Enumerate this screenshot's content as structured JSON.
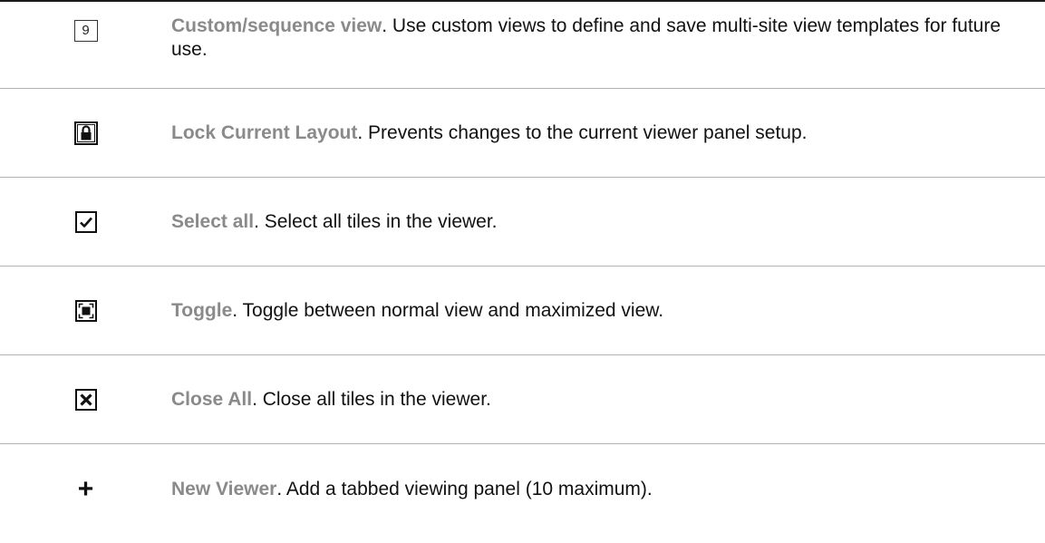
{
  "rows": [
    {
      "icon": "number-nine-icon",
      "icon_text": "9",
      "term": "Custom/sequence view",
      "text": ". Use custom views to define and save multi-site view templates for future use."
    },
    {
      "icon": "lock-icon",
      "term": "Lock Current Layout",
      "text": ". Prevents changes to the current viewer panel setup."
    },
    {
      "icon": "checkbox-icon",
      "term": "Select all",
      "text": ". Select all tiles in the viewer."
    },
    {
      "icon": "maximize-icon",
      "term": "Toggle",
      "text": ". Toggle between normal view and maximized view."
    },
    {
      "icon": "close-icon",
      "term": "Close All",
      "text": ". Close all tiles in the viewer."
    },
    {
      "icon": "plus-icon",
      "icon_text": "+",
      "term": "New Viewer",
      "text": ". Add a tabbed viewing panel (10 maximum)."
    }
  ],
  "colors": {
    "term": "#8a8a8a",
    "text": "#111111",
    "rule": "#b3b3b3",
    "top_rule": "#1a1a1a"
  }
}
